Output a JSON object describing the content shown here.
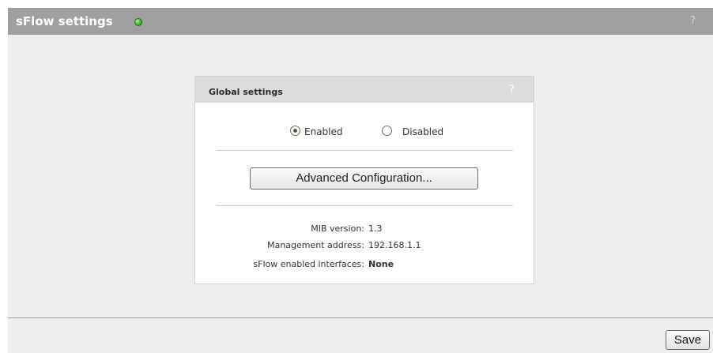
{
  "page": {
    "title": "sFlow settings",
    "help": "?"
  },
  "global_settings": {
    "title": "Global settings",
    "help": "?",
    "radio_options": [
      {
        "label": "Enabled",
        "checked": true
      },
      {
        "label": "Disabled",
        "checked": false
      }
    ],
    "advanced_button_label": "Advanced Configuration...",
    "info": [
      {
        "label": "MIB version:",
        "value": "1.3"
      },
      {
        "label": "Management address:",
        "value": "192.168.1.1"
      },
      {
        "label": "sFlow enabled interfaces:",
        "value": "None"
      }
    ]
  },
  "footer": {
    "save_label": "Save"
  },
  "colors": {
    "title_bar": "#a0a0a0",
    "page_background": "#eeeeee",
    "status_led": "#4cc236"
  },
  "icons": {
    "status": "status-led-icon",
    "help": "help-icon"
  }
}
